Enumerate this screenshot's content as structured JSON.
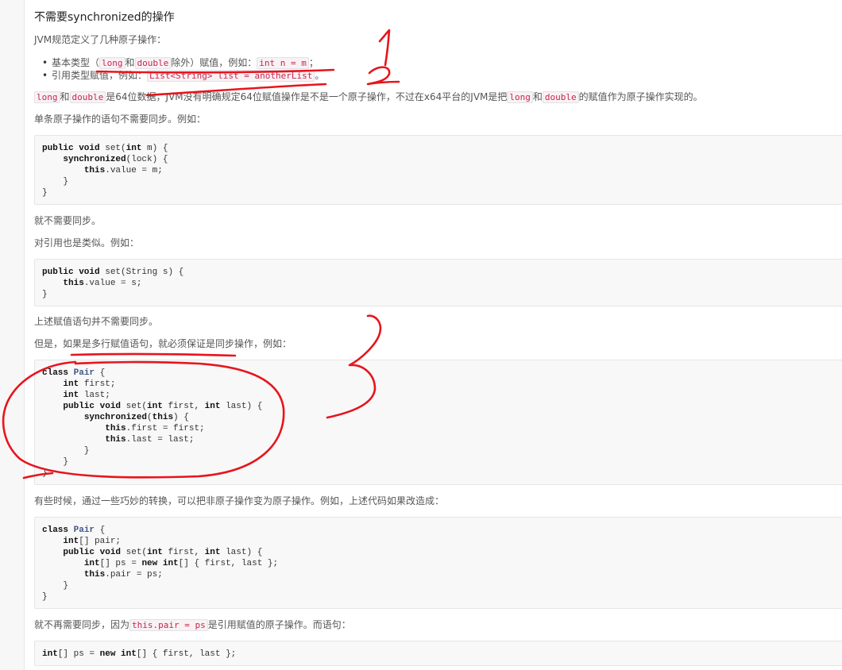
{
  "heading": "不需要synchronized的操作",
  "intro": "JVM规范定义了几种原子操作：",
  "bullet1": {
    "pre": "基本类型（",
    "c1": "long",
    "mid": "和",
    "c2": "double",
    "post": "除外）赋值，例如：",
    "c3": "int n = m",
    "end": "；"
  },
  "bullet2": {
    "pre": "引用类型赋值，例如：",
    "c1": "List<String> list = anotherList",
    "end": "。"
  },
  "para_long": {
    "c1": "long",
    "t1": "和",
    "c2": "double",
    "t2": "是64位数据，JVM没有明确规定64位赋值操作是不是一个原子操作，不过在x64平台的JVM是把",
    "c3": "long",
    "t3": "和",
    "c4": "double",
    "t4": "的赋值作为原子操作实现的。"
  },
  "para_single": "单条原子操作的语句不需要同步。例如：",
  "code1": [
    [
      [
        "kw",
        "public void"
      ],
      [
        "t",
        " set("
      ],
      [
        "kw",
        "int"
      ],
      [
        "t",
        " m) {"
      ]
    ],
    [
      [
        "t",
        "    "
      ],
      [
        "kw",
        "synchronized"
      ],
      [
        "t",
        "(lock) {"
      ]
    ],
    [
      [
        "t",
        "        "
      ],
      [
        "kw",
        "this"
      ],
      [
        "t",
        ".value = m;"
      ]
    ],
    [
      [
        "t",
        "    }"
      ]
    ],
    [
      [
        "t",
        "}"
      ]
    ]
  ],
  "para_nosync": "就不需要同步。",
  "para_ref": "对引用也是类似。例如：",
  "code2": [
    [
      [
        "kw",
        "public void"
      ],
      [
        "t",
        " set(String s) {"
      ]
    ],
    [
      [
        "t",
        "    "
      ],
      [
        "kw",
        "this"
      ],
      [
        "t",
        ".value = s;"
      ]
    ],
    [
      [
        "t",
        "}"
      ]
    ]
  ],
  "para_above": "上述赋值语句并不需要同步。",
  "para_but": "但是，如果是多行赋值语句，就必须保证是同步操作，例如：",
  "code3": [
    [
      [
        "kw",
        "class"
      ],
      [
        "t",
        " "
      ],
      [
        "ty",
        "Pair"
      ],
      [
        "t",
        " {"
      ]
    ],
    [
      [
        "t",
        "    "
      ],
      [
        "kw",
        "int"
      ],
      [
        "t",
        " first;"
      ]
    ],
    [
      [
        "t",
        "    "
      ],
      [
        "kw",
        "int"
      ],
      [
        "t",
        " last;"
      ]
    ],
    [
      [
        "t",
        "    "
      ],
      [
        "kw",
        "public void"
      ],
      [
        "t",
        " set("
      ],
      [
        "kw",
        "int"
      ],
      [
        "t",
        " first, "
      ],
      [
        "kw",
        "int"
      ],
      [
        "t",
        " last) {"
      ]
    ],
    [
      [
        "t",
        "        "
      ],
      [
        "kw",
        "synchronized"
      ],
      [
        "t",
        "("
      ],
      [
        "kw",
        "this"
      ],
      [
        "t",
        ") {"
      ]
    ],
    [
      [
        "t",
        "            "
      ],
      [
        "kw",
        "this"
      ],
      [
        "t",
        ".first = first;"
      ]
    ],
    [
      [
        "t",
        "            "
      ],
      [
        "kw",
        "this"
      ],
      [
        "t",
        ".last = last;"
      ]
    ],
    [
      [
        "t",
        "        }"
      ]
    ],
    [
      [
        "t",
        "    }"
      ]
    ],
    [
      [
        "t",
        "}"
      ]
    ]
  ],
  "para_sometimes": "有些时候，通过一些巧妙的转换，可以把非原子操作变为原子操作。例如，上述代码如果改造成：",
  "code4": [
    [
      [
        "kw",
        "class"
      ],
      [
        "t",
        " "
      ],
      [
        "ty",
        "Pair"
      ],
      [
        "t",
        " {"
      ]
    ],
    [
      [
        "t",
        "    "
      ],
      [
        "kw",
        "int"
      ],
      [
        "t",
        "[] pair;"
      ]
    ],
    [
      [
        "t",
        "    "
      ],
      [
        "kw",
        "public void"
      ],
      [
        "t",
        " set("
      ],
      [
        "kw",
        "int"
      ],
      [
        "t",
        " first, "
      ],
      [
        "kw",
        "int"
      ],
      [
        "t",
        " last) {"
      ]
    ],
    [
      [
        "t",
        "        "
      ],
      [
        "kw",
        "int"
      ],
      [
        "t",
        "[] ps = "
      ],
      [
        "kw",
        "new"
      ],
      [
        "t",
        " "
      ],
      [
        "kw",
        "int"
      ],
      [
        "t",
        "[] { first, last };"
      ]
    ],
    [
      [
        "t",
        "        "
      ],
      [
        "kw",
        "this"
      ],
      [
        "t",
        ".pair = ps;"
      ]
    ],
    [
      [
        "t",
        "    }"
      ]
    ],
    [
      [
        "t",
        "}"
      ]
    ]
  ],
  "para_nomore": {
    "t1": "就不再需要同步，因为",
    "c1": "this.pair = ps",
    "t2": "是引用赋值的原子操作。而语句："
  },
  "code5": [
    [
      [
        "kw",
        "int"
      ],
      [
        "t",
        "[] ps = "
      ],
      [
        "kw",
        "new"
      ],
      [
        "t",
        " "
      ],
      [
        "kw",
        "int"
      ],
      [
        "t",
        "[] { first, last };"
      ]
    ]
  ],
  "annotations": {
    "color": "#e8141c"
  }
}
